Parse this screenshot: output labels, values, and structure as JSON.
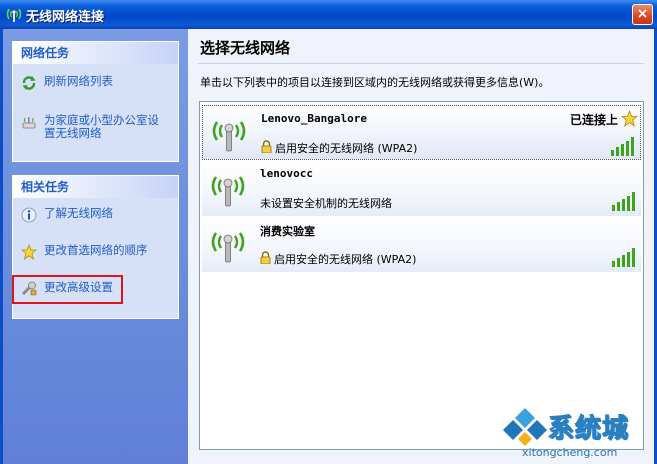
{
  "window": {
    "title": "无线网络连接",
    "close_glyph": "×"
  },
  "sidebar": {
    "network_tasks": {
      "header": "网络任务",
      "items": [
        {
          "label": "刷新网络列表",
          "icon": "refresh-icon"
        },
        {
          "label_line1": "为家庭或小型办公室设",
          "label_line2": "置无线网络",
          "icon": "setup-network-icon"
        }
      ]
    },
    "related_tasks": {
      "header": "相关任务",
      "items": [
        {
          "label": "了解无线网络",
          "icon": "info-icon"
        },
        {
          "label": "更改首选网络的顺序",
          "icon": "star-icon"
        },
        {
          "label": "更改高级设置",
          "icon": "advanced-settings-icon",
          "highlighted": true
        }
      ]
    }
  },
  "main": {
    "title": "选择无线网络",
    "description": "单击以下列表中的项目以连接到区域内的无线网络或获得更多信息(W)。",
    "networks": [
      {
        "name": "Lenovo_Bangalore",
        "security": "启用安全的无线网络 (WPA2)",
        "secured": true,
        "connected_label": "已连接上",
        "selected": true,
        "signal_bars": 5
      },
      {
        "name": "lenovocc",
        "security": "未设置安全机制的无线网络",
        "secured": false,
        "signal_bars": 5
      },
      {
        "name": "消费实验室",
        "security": "启用安全的无线网络 (WPA2)",
        "secured": true,
        "signal_bars": 5
      }
    ]
  },
  "watermark": {
    "text": "系统城",
    "url": "xitongcheng.com"
  },
  "colors": {
    "title_bar": "#0047c7",
    "sidebar": "#6c8fdc",
    "link": "#215dc6",
    "highlight_box": "#e0141a",
    "signal_green": "#3fa31f"
  }
}
